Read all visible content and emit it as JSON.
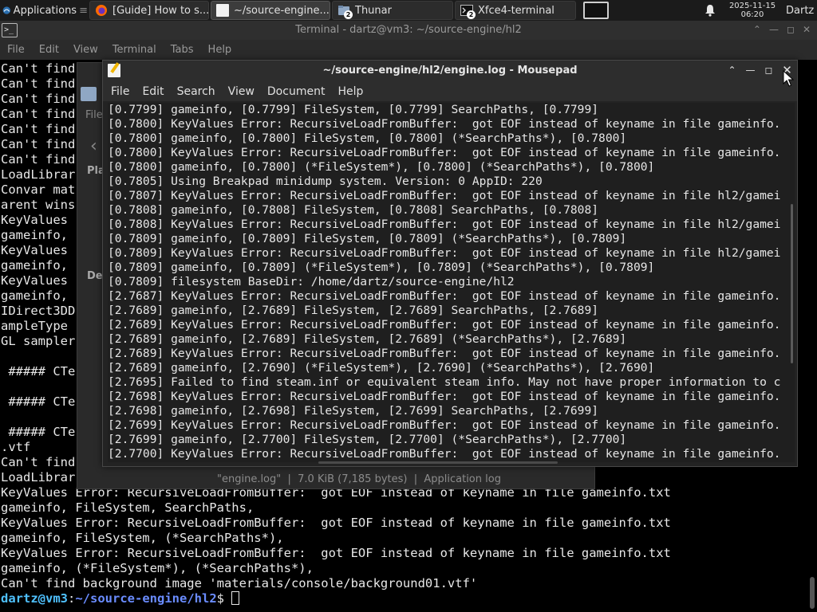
{
  "panel": {
    "apps_label": "Applications",
    "tasks": [
      {
        "label": "[Guide] How to s..."
      },
      {
        "label": "~/source-engine..."
      },
      {
        "label": "Thunar",
        "count": "2"
      },
      {
        "label": "Xfce4-terminal",
        "count": "2"
      }
    ],
    "date": "2025-11-15",
    "time": "06:20",
    "user": "Dartz"
  },
  "terminal": {
    "title": "Terminal - dartz@vm3: ~/source-engine/hl2",
    "menu": [
      "File",
      "Edit",
      "View",
      "Terminal",
      "Tabs",
      "Help"
    ],
    "lines": [
      "Can't find mo",
      "Can't find m",
      "Can't find",
      "Can't find",
      "Can't find",
      "Can't find",
      "Can't find",
      "LoadLibrar",
      "Convar mat",
      "arent wins",
      "KeyValues",
      "gameinfo,",
      "KeyValues",
      "gameinfo,",
      "KeyValues",
      "gameinfo,",
      "IDirect3DD",
      "ampleType",
      "GL sampler",
      "",
      " ##### CTe",
      "",
      " ##### CTe",
      "",
      " ##### CTe",
      ".vtf",
      "Can't find",
      "LoadLibrar",
      "KeyValues Error: RecursiveLoadFromBuffer:  got EOF instead of keyname in file gameinfo.txt",
      "gameinfo, FileSystem, SearchPaths,",
      "KeyValues Error: RecursiveLoadFromBuffer:  got EOF instead of keyname in file gameinfo.txt",
      "gameinfo, FileSystem, (*SearchPaths*),",
      "KeyValues Error: RecursiveLoadFromBuffer:  got EOF instead of keyname in file gameinfo.txt",
      "gameinfo, (*FileSystem*), (*SearchPaths*),",
      "Can't find background image 'materials/console/background01.vtf'"
    ],
    "prompt_user": "dartz@vm3",
    "prompt_sep": ":",
    "prompt_path": "~/source-engine/hl2",
    "prompt_symbol": "$ "
  },
  "thunar": {
    "status": "\"engine.log\"  |  7.0 KiB (7,185 bytes)  |  Application log"
  },
  "mousepad": {
    "title": "~/source-engine/hl2/engine.log - Mousepad",
    "menu": [
      "File",
      "Edit",
      "Search",
      "View",
      "Document",
      "Help"
    ],
    "lines": [
      "[0.7799] gameinfo, [0.7799] FileSystem, [0.7799] SearchPaths, [0.7799]",
      "[0.7800] KeyValues Error: RecursiveLoadFromBuffer:  got EOF instead of keyname in file gameinfo.",
      "[0.7800] gameinfo, [0.7800] FileSystem, [0.7800] (*SearchPaths*), [0.7800]",
      "[0.7800] KeyValues Error: RecursiveLoadFromBuffer:  got EOF instead of keyname in file gameinfo.",
      "[0.7800] gameinfo, [0.7800] (*FileSystem*), [0.7800] (*SearchPaths*), [0.7800]",
      "[0.7805] Using Breakpad minidump system. Version: 0 AppID: 220",
      "[0.7807] KeyValues Error: RecursiveLoadFromBuffer:  got EOF instead of keyname in file hl2/gamei",
      "[0.7808] gameinfo, [0.7808] FileSystem, [0.7808] SearchPaths, [0.7808]",
      "[0.7808] KeyValues Error: RecursiveLoadFromBuffer:  got EOF instead of keyname in file hl2/gamei",
      "[0.7809] gameinfo, [0.7809] FileSystem, [0.7809] (*SearchPaths*), [0.7809]",
      "[0.7809] KeyValues Error: RecursiveLoadFromBuffer:  got EOF instead of keyname in file hl2/gamei",
      "[0.7809] gameinfo, [0.7809] (*FileSystem*), [0.7809] (*SearchPaths*), [0.7809]",
      "[0.7809] filesystem BaseDir: /home/dartz/source-engine/hl2",
      "[2.7687] KeyValues Error: RecursiveLoadFromBuffer:  got EOF instead of keyname in file gameinfo.",
      "[2.7689] gameinfo, [2.7689] FileSystem, [2.7689] SearchPaths, [2.7689]",
      "[2.7689] KeyValues Error: RecursiveLoadFromBuffer:  got EOF instead of keyname in file gameinfo.",
      "[2.7689] gameinfo, [2.7689] FileSystem, [2.7689] (*SearchPaths*), [2.7689]",
      "[2.7689] KeyValues Error: RecursiveLoadFromBuffer:  got EOF instead of keyname in file gameinfo.",
      "[2.7689] gameinfo, [2.7690] (*FileSystem*), [2.7690] (*SearchPaths*), [2.7690]",
      "[2.7695] Failed to find steam.inf or equivalent steam info. May not have proper information to c",
      "[2.7698] KeyValues Error: RecursiveLoadFromBuffer:  got EOF instead of keyname in file gameinfo.",
      "[2.7698] gameinfo, [2.7698] FileSystem, [2.7699] SearchPaths, [2.7699]",
      "[2.7699] KeyValues Error: RecursiveLoadFromBuffer:  got EOF instead of keyname in file gameinfo.",
      "[2.7699] gameinfo, [2.7700] FileSystem, [2.7700] (*SearchPaths*), [2.7700]",
      "[2.7700] KeyValues Error: RecursiveLoadFromBuffer:  got EOF instead of keyname in file gameinfo."
    ]
  }
}
